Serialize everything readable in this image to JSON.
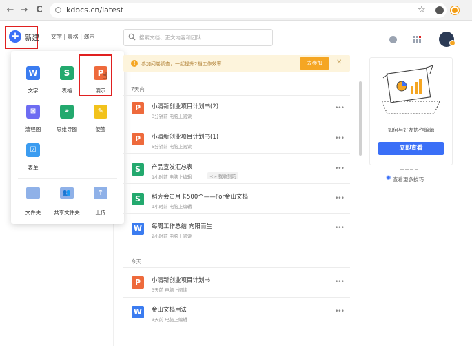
{
  "browser": {
    "back": "←",
    "forward": "→",
    "reload": "C",
    "home": "⌂",
    "url": "kdocs.cn/latest",
    "bookmark": "☆"
  },
  "left": {
    "new_label": "新建",
    "quick_links": "文字 | 表格 | 演示"
  },
  "dropdown": {
    "items": [
      {
        "label": "文字",
        "glyph": "W",
        "color": "#3b7cf0"
      },
      {
        "label": "表格",
        "glyph": "S",
        "color": "#23a96e"
      },
      {
        "label": "演示",
        "glyph": "P",
        "color": "#ee6a3c"
      },
      {
        "label": "流程图",
        "glyph": "⊡",
        "color": "#6d6cf2"
      },
      {
        "label": "思维导图",
        "glyph": "⚭",
        "color": "#23a96e"
      },
      {
        "label": "便签",
        "glyph": "✎",
        "color": "#f2c21b"
      },
      {
        "label": "表单",
        "glyph": "☑",
        "color": "#3b9cf0"
      }
    ],
    "bottom": [
      {
        "label": "文件夹",
        "color": "#8fb1e8"
      },
      {
        "label": "共享文件夹",
        "color": "#8fb1e8"
      },
      {
        "label": "上传",
        "color": "#8fb1e8"
      }
    ]
  },
  "search": {
    "placeholder": "搜索文档、正文内容和团队"
  },
  "banner": {
    "text": "参加问卷调查，一起提升2档工作效率",
    "button": "去参加",
    "close": "✕"
  },
  "sections": {
    "week": "7天内",
    "today": "今天"
  },
  "files": [
    {
      "name": "小清新创业项目计划书(2)",
      "meta": "3分钟前    电脑上阅读",
      "type": "P",
      "color": "#ee6a3c"
    },
    {
      "name": "小清新创业项目计划书(1)",
      "meta": "5分钟前    电脑上阅读",
      "type": "P",
      "color": "#ee6a3c"
    },
    {
      "name": "产品宣发汇总表",
      "meta": "1小时前    电脑上编辑",
      "type": "S",
      "color": "#23a96e",
      "tag": "<∞ 我收到的"
    },
    {
      "name": "稻壳会员月卡500个——For金山文档",
      "meta": "1小时前    电脑上编辑",
      "type": "S",
      "color": "#23a96e"
    },
    {
      "name": "每周工作总结  向阳而生",
      "meta": "2小时前    电脑上阅读",
      "type": "W",
      "color": "#3b7cf0"
    },
    {
      "name": "小清新创业项目计划书",
      "meta": "3天前    电脑上阅读",
      "type": "P",
      "color": "#ee6a3c"
    },
    {
      "name": "金山文档用法",
      "meta": "3天前    电脑上编辑",
      "type": "W",
      "color": "#3b7cf0"
    }
  ],
  "more": "•••",
  "card": {
    "text": "如何与好友协作编辑",
    "button": "立即查看",
    "tips": "查看更多技巧"
  }
}
